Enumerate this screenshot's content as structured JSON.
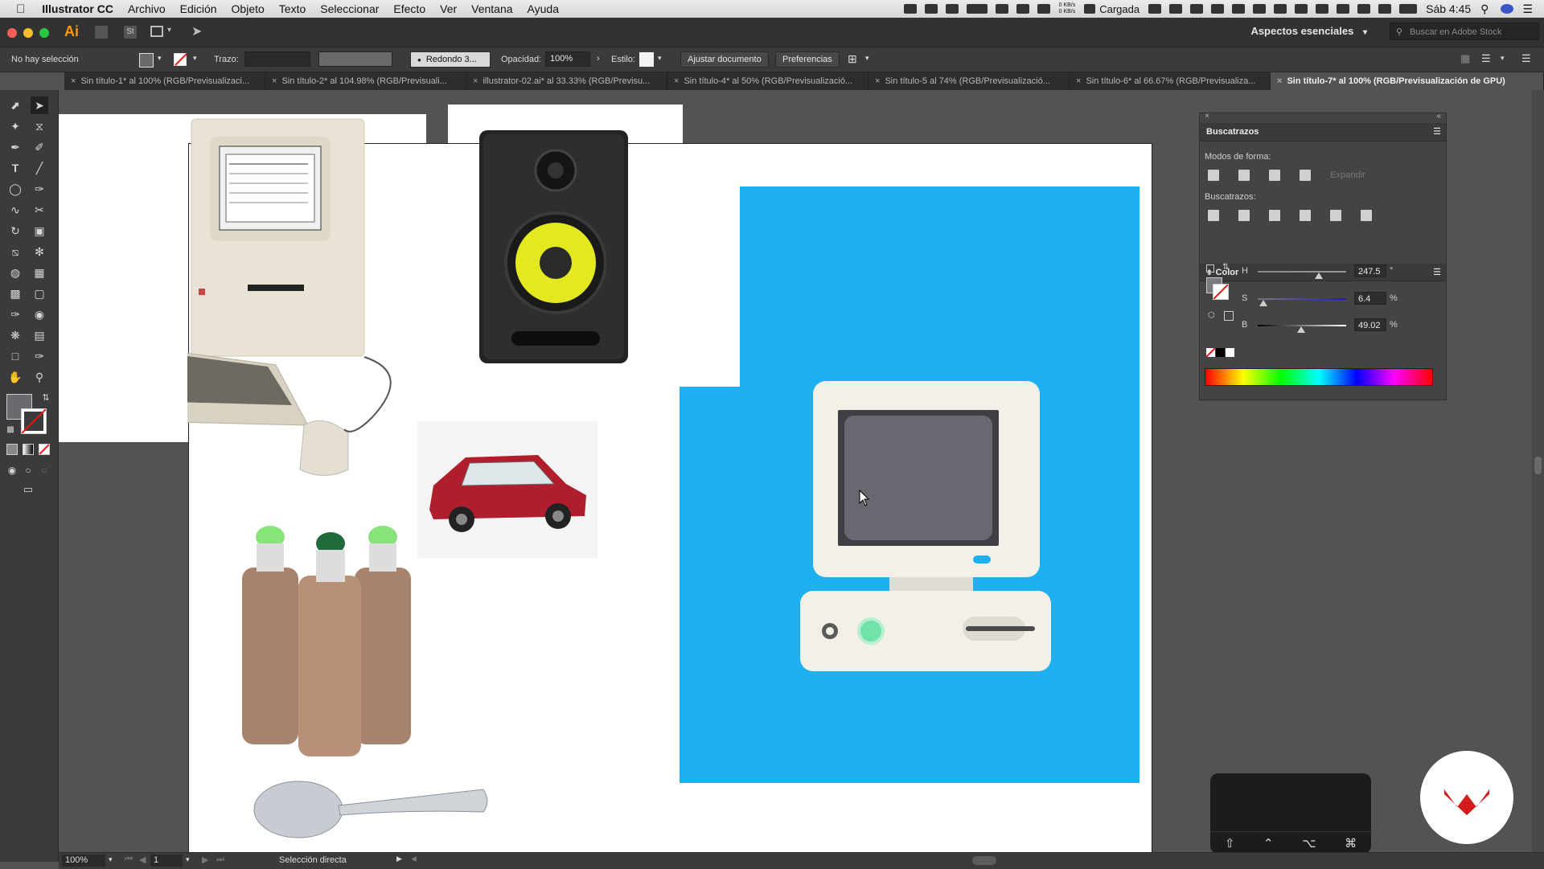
{
  "menubar": {
    "app": "Illustrator CC",
    "items": [
      "Archivo",
      "Edición",
      "Objeto",
      "Texto",
      "Seleccionar",
      "Efecto",
      "Ver",
      "Ventana",
      "Ayuda"
    ],
    "net_up": "0 KB/s",
    "net_down": "0 KB/s",
    "battery_label": "Cargada",
    "clock": "Sáb 4:45"
  },
  "appbar": {
    "logo": "Ai",
    "st_label": "St",
    "workspace": "Aspectos esenciales",
    "stock_placeholder": "Buscar en Adobe Stock"
  },
  "control": {
    "selection": "No hay selección",
    "stroke_label": "Trazo:",
    "brush": "Redondo 3...",
    "opacity_label": "Opacidad:",
    "opacity_value": "100%",
    "style_label": "Estilo:",
    "fit_doc": "Ajustar documento",
    "prefs": "Preferencias"
  },
  "tabs": [
    {
      "label": "Sin título-1* al 100% (RGB/Previsualizaci..."
    },
    {
      "label": "Sin título-2* al 104.98% (RGB/Previsuali..."
    },
    {
      "label": "illustrator-02.ai* al 33.33% (RGB/Previsu..."
    },
    {
      "label": "Sin título-4* al 50% (RGB/Previsualizació..."
    },
    {
      "label": "Sin título-5 al 74% (RGB/Previsualizació..."
    },
    {
      "label": "Sin título-6* al 66.67% (RGB/Previsualiza..."
    },
    {
      "label": "Sin título-7* al 100% (RGB/Previsualización de GPU)"
    }
  ],
  "pathfinder": {
    "title": "Buscatrazos",
    "shape_modes": "Modos de forma:",
    "expand": "Expandir",
    "pathfinders": "Buscatrazos:"
  },
  "color": {
    "title": "Color",
    "h_label": "H",
    "h_value": "247.5",
    "h_unit": "°",
    "h_level": 0.69,
    "s_label": "S",
    "s_value": "6.4",
    "s_unit": "%",
    "s_level": 0.064,
    "b_label": "B",
    "b_value": "49.02",
    "b_unit": "%",
    "b_level": 0.49
  },
  "status": {
    "zoom": "100%",
    "page": "1",
    "tool": "Selección directa"
  },
  "colors": {
    "accent_blue": "#1fb0f2",
    "monitor_body": "#f3f0e7",
    "screen": "#686870",
    "led": "#6fe3a8",
    "brand_red": "#d31d1d"
  }
}
